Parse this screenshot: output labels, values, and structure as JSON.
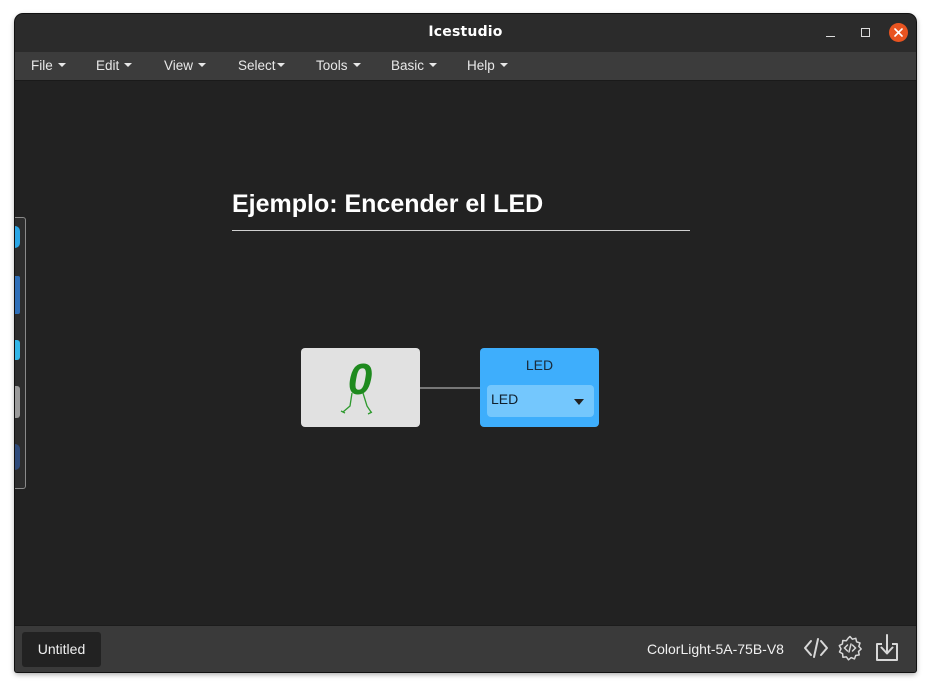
{
  "window": {
    "title": "Icestudio"
  },
  "menubar": {
    "items": [
      {
        "label": "File"
      },
      {
        "label": "Edit"
      },
      {
        "label": "View"
      },
      {
        "label": "Select"
      },
      {
        "label": "Tools"
      },
      {
        "label": "Basic"
      },
      {
        "label": "Help"
      }
    ]
  },
  "canvas": {
    "heading": "Ejemplo: Encender el LED",
    "constant_block": {
      "icon": "bit-zero-walking-icon",
      "icon_text": "0"
    },
    "led_block": {
      "title": "LED",
      "selected_pin": "LED"
    }
  },
  "footer": {
    "tab_label": "Untitled",
    "board_name": "ColorLight-5A-75B-V8",
    "icons": [
      "verify-code-icon",
      "build-icon",
      "upload-icon"
    ]
  },
  "colors": {
    "canvas_bg": "#222222",
    "menubar_bg": "#3c3c3c",
    "led_block": "#3eaefc",
    "led_select": "#74c7fd",
    "constant_block": "#e1e1e1",
    "constant_glyph": "#1e8a1e",
    "close_button": "#e95420"
  }
}
